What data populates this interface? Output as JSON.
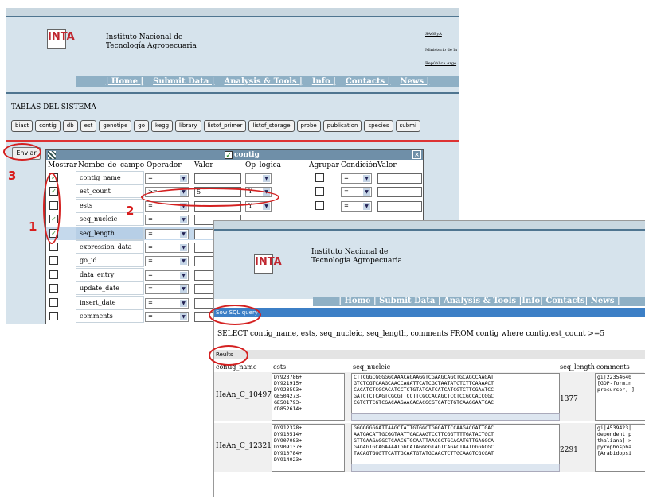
{
  "site": {
    "logo": "INTA",
    "institution": [
      "Instituto Nacional de",
      "Tecnología Agropecuaria"
    ],
    "links": [
      "SAGPyA",
      "Ministerio de la",
      "República Arge"
    ],
    "nav": [
      "| Home |",
      "Submit Data |",
      "Analysis & Tools |",
      "Info |",
      "Contacts |",
      "News |"
    ],
    "nav2": "| Home | Submit Data | Analysis & Tools |Info| Contacts| News |"
  },
  "tables": {
    "title": "TABLAS DEL SISTEMA",
    "tabs": [
      "biast",
      "contig",
      "db",
      "est",
      "genotipe",
      "go",
      "kegg",
      "library",
      "listof_primer",
      "listof_storage",
      "probe",
      "publication",
      "species",
      "submi"
    ]
  },
  "enviar_label": "Enviar",
  "dialog": {
    "title": "contig",
    "headers": [
      "Mostrar",
      "Nombe_de_campo",
      "Operador",
      "Valor",
      "Op_logica",
      "Agrupar",
      "Condición",
      "Valor"
    ],
    "rows": [
      {
        "name": "contig_name",
        "checked": true,
        "op": "=",
        "val": "",
        "logic": "",
        "cond": "="
      },
      {
        "name": "est_count",
        "checked": true,
        "op": ">=",
        "val": "5",
        "logic": "Y",
        "cond": "="
      },
      {
        "name": "ests",
        "checked": false,
        "op": "=",
        "val": "",
        "logic": "Y",
        "cond": "="
      },
      {
        "name": "seq_nucleic",
        "checked": true,
        "op": "=",
        "val": "",
        "logic": "",
        "cond": ""
      },
      {
        "name": "seq_length",
        "checked": true,
        "op": "=",
        "val": "",
        "logic": "",
        "cond": ""
      },
      {
        "name": "expression_data",
        "checked": false,
        "op": "=",
        "val": "",
        "logic": "",
        "cond": ""
      },
      {
        "name": "go_id",
        "checked": false,
        "op": "=",
        "val": "",
        "logic": "",
        "cond": ""
      },
      {
        "name": "data_entry",
        "checked": false,
        "op": "=",
        "val": "",
        "logic": "",
        "cond": ""
      },
      {
        "name": "update_date",
        "checked": false,
        "op": "=",
        "val": "",
        "logic": "",
        "cond": ""
      },
      {
        "name": "insert_date",
        "checked": false,
        "op": "=",
        "val": "",
        "logic": "",
        "cond": ""
      },
      {
        "name": "comments",
        "checked": false,
        "op": "=",
        "val": "",
        "logic": "",
        "cond": ""
      }
    ]
  },
  "annotations": [
    "1",
    "2",
    "3"
  ],
  "results": {
    "sql_header": "Sow SQL query",
    "sql": "SELECT contig_name, ests, seq_nucleic, seq_length, comments FROM contig where contig.est_count >=5",
    "results_header": "Reults",
    "columns": [
      "contig_name",
      "ests",
      "seq_nucleic",
      "seq_length",
      "comments"
    ],
    "rows": [
      {
        "contig_name": "HeAn_C_10497",
        "ests": "DY923786+\nDY921915+\nDY923593+\nGE504273-\nGE501793-\nCD852614+",
        "seq": "CTTCGGCGGGGGCAAACAGAAGGTCGAAGCAGCTGCAGCCAAGAT\nGTCTCGTCAAGCAACCAGATTCATCGCTAATATCTCTTCAAAACT\nCACATCTCGCACATCCTCTGTATCATCATCATCGTCTTCGAATCC\nGATCTCTCAGTCGCGTTCCTTCGCCACAGCTCCTCCGCCACCGGC\nCGTCTTCGTCGACAAGAACACACGCGTCATCTGTCAAGGAATCAC",
        "length": "1377",
        "comments": "gi|22354640\n[GDP-formin\nprecursor, ]"
      },
      {
        "contig_name": "HeAn_C_12321",
        "ests": "DY912328+\nDY910514+\nDY907083+\nDY909137+\nDY910784+\nDY914023+",
        "seq": "GGGGGGGGATTAAGCTATTGTGGCTGGGATTCCAAGACGATTGAC\nAATGACATTGCGGTAATTGACAAGTCCTTCGGTTTTGATACTGCT\nGTTGAAGAGGCTCAACGTGCAATTAACGCTGCACATGTTGAGGCA\nGAGAGTGCAGAAAATGGCATAGGGGTAGTCAGACTAATGGGGCGC\nTACAGTGGGTTCATTGCAATGTATGCAACTCTTGCAAGTCGCGAT",
        "length": "2291",
        "comments": "gi|4539423|\ndependent p\nthaliana] >\npyrophospha\n[Arabidopsi"
      }
    ]
  },
  "colors": {
    "accent": "#3c7fc6",
    "annotation": "#d81d1d",
    "nav": "#8fb0c5"
  }
}
